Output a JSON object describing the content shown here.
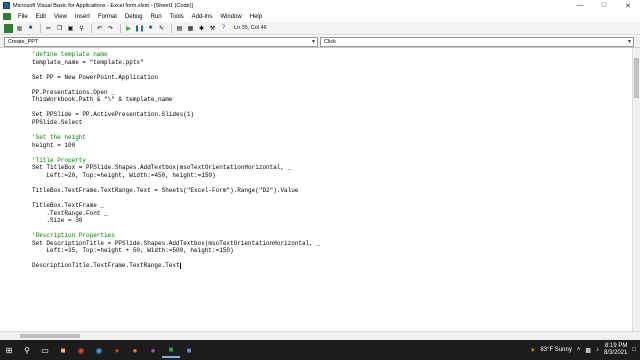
{
  "window": {
    "title": "Microsoft Visual Basic for Applications - Excel form.xlsm - [Sheet1 (Code)]"
  },
  "menu": [
    "File",
    "Edit",
    "View",
    "Insert",
    "Format",
    "Debug",
    "Run",
    "Tools",
    "Add-Ins",
    "Window",
    "Help"
  ],
  "toolbar": {
    "position": "Ln 35, Col 46"
  },
  "selectors": {
    "object": "Create_PPT",
    "procedure": "Click"
  },
  "code": [
    {
      "text": "'define template name",
      "kind": "comment"
    },
    {
      "text": "template_name = \"template.pptx\"",
      "kind": "normal"
    },
    {
      "text": "",
      "kind": "normal"
    },
    {
      "text": "Set PP = New PowerPoint.Application",
      "kind": "normal"
    },
    {
      "text": "",
      "kind": "normal"
    },
    {
      "text": "PP.Presentations.Open _",
      "kind": "normal"
    },
    {
      "text": "ThisWorkbook.Path & \"\\\" & template_name",
      "kind": "normal"
    },
    {
      "text": "",
      "kind": "normal"
    },
    {
      "text": "Set PPSlide = PP.ActivePresentation.Slides(1)",
      "kind": "normal"
    },
    {
      "text": "PPSlide.Select",
      "kind": "normal"
    },
    {
      "text": "",
      "kind": "normal"
    },
    {
      "text": "'Set the height",
      "kind": "comment"
    },
    {
      "text": "height = 100",
      "kind": "normal"
    },
    {
      "text": "",
      "kind": "normal"
    },
    {
      "text": "'Title Property",
      "kind": "comment"
    },
    {
      "text": "Set TitleBox = PPSlide.Shapes.AddTextbox(msoTextOrientationHorizontal, _",
      "kind": "normal"
    },
    {
      "text": "    Left:=20, Top:=height, Width:=450, height:=150)",
      "kind": "normal"
    },
    {
      "text": "",
      "kind": "normal"
    },
    {
      "text": "TitleBox.TextFrame.TextRange.Text = Sheets(\"Excel-Form\").Range(\"D2\").Value",
      "kind": "normal"
    },
    {
      "text": "",
      "kind": "normal"
    },
    {
      "text": "TitleBox.TextFrame _",
      "kind": "normal"
    },
    {
      "text": "    .TextRange.Font _",
      "kind": "normal"
    },
    {
      "text": "    .Size = 30",
      "kind": "normal"
    },
    {
      "text": "",
      "kind": "normal"
    },
    {
      "text": "'Description Properties",
      "kind": "comment"
    },
    {
      "text": "Set DescriptionTitle = PPSlide.Shapes.AddTextbox(msoTextOrientationHorizontal, _",
      "kind": "normal"
    },
    {
      "text": "    Left:=35, Top:=height + 50, Width:=500, height:=150)",
      "kind": "normal"
    },
    {
      "text": "",
      "kind": "normal"
    },
    {
      "text": "DescriptionTitle.TextFrame.TextRange.Text",
      "kind": "normal"
    }
  ],
  "taskbar": {
    "weather": "83°F  Sunny",
    "time": "8:19 PM",
    "date": "8/3/2021"
  },
  "colors": {
    "comment": "#008000",
    "taskbar": "#1c1c1c"
  }
}
